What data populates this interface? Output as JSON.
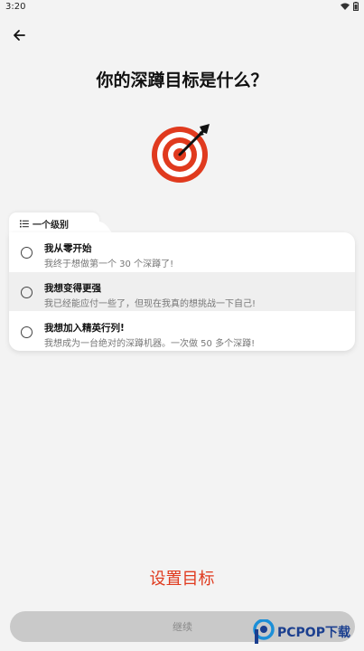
{
  "status": {
    "time": "3:20"
  },
  "header": {
    "title": "你的深蹲目标是什么？"
  },
  "level": {
    "tab_label": "一个级别"
  },
  "options": [
    {
      "title": "我从零开始",
      "desc": "我终于想做第一个 30 个深蹲了!"
    },
    {
      "title": "我想变得更强",
      "desc": "我已经能应付一些了，但现在我真的想挑战一下自己!"
    },
    {
      "title": "我想加入精英行列!",
      "desc": "我想成为一台绝对的深蹲机器。一次做 50 多个深蹲!"
    }
  ],
  "footer": {
    "set_goal": "设置目标",
    "continue_label": "继续"
  },
  "watermark": {
    "brand": "PCPOP下载"
  },
  "colors": {
    "accent": "#e03a1e",
    "background": "#f3f3f3",
    "button_disabled": "#c9c9c9"
  },
  "icons": {
    "back": "arrow-left-icon",
    "target": "target-arrow-icon",
    "list": "list-icon"
  }
}
